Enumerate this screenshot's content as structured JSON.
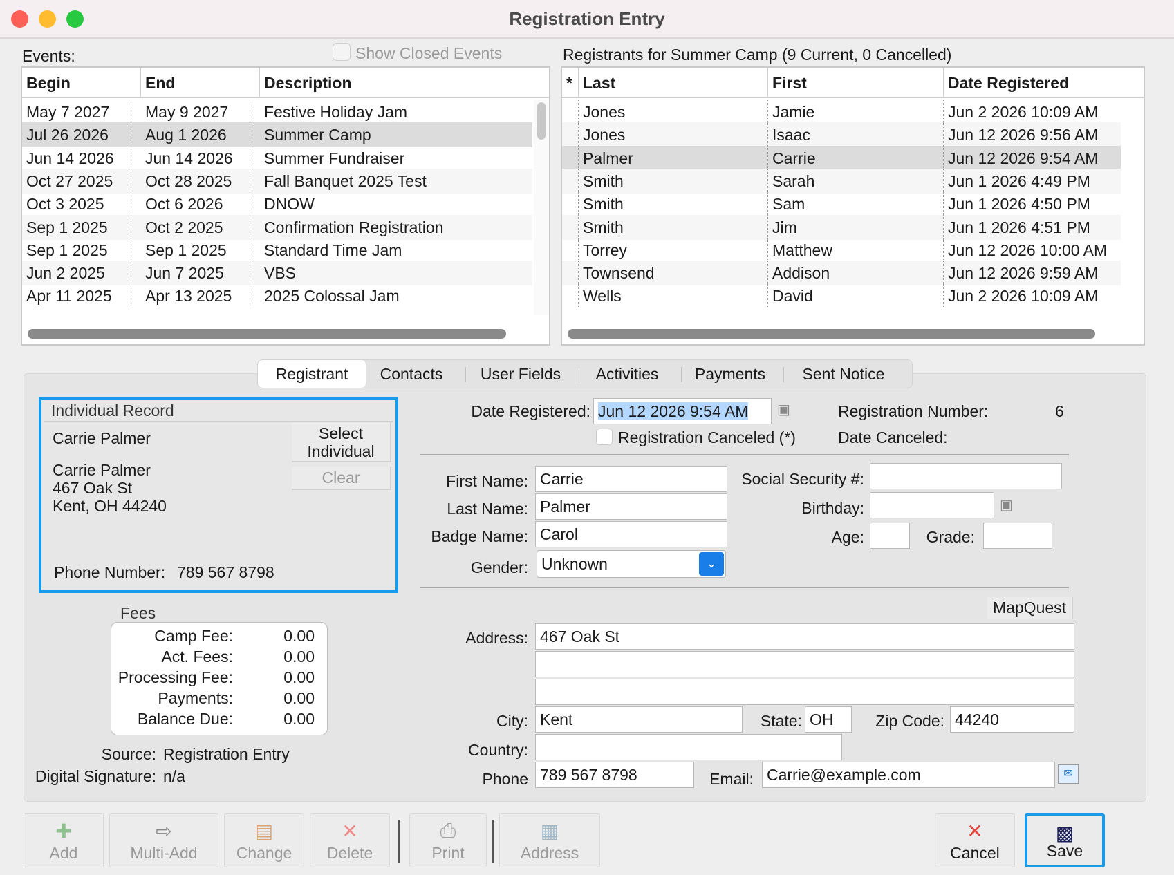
{
  "window": {
    "title": "Registration Entry"
  },
  "events": {
    "label": "Events:",
    "show_closed_label": "Show Closed Events",
    "columns": [
      "Begin",
      "End",
      "Description"
    ],
    "rows": [
      [
        "May 7 2027",
        "May 9 2027",
        "Festive Holiday Jam"
      ],
      [
        "Jul 26 2026",
        "Aug 1 2026",
        "Summer Camp"
      ],
      [
        "Jun 14 2026",
        "Jun 14 2026",
        "Summer Fundraiser"
      ],
      [
        "Oct 27 2025",
        "Oct 28 2025",
        "Fall Banquet 2025 Test"
      ],
      [
        "Oct 3 2025",
        "Oct 6 2026",
        "DNOW"
      ],
      [
        "Sep 1 2025",
        "Oct 2 2025",
        "Confirmation Registration"
      ],
      [
        "Sep 1 2025",
        "Sep 1 2025",
        "Standard Time Jam"
      ],
      [
        "Jun 2 2025",
        "Jun 7 2025",
        "VBS"
      ],
      [
        "Apr 11 2025",
        "Apr 13 2025",
        "2025 Colossal Jam"
      ]
    ],
    "selected_index": 1
  },
  "registrants": {
    "label": "Registrants for Summer Camp (9 Current, 0 Cancelled)",
    "columns": [
      "*",
      "Last",
      "First",
      "Date Registered"
    ],
    "rows": [
      [
        "",
        "Jones",
        "Jamie",
        "Jun 2 2026 10:09 AM"
      ],
      [
        "",
        "Jones",
        "Isaac",
        "Jun 12 2026 9:56 AM"
      ],
      [
        "",
        "Palmer",
        "Carrie",
        "Jun 12 2026 9:54 AM"
      ],
      [
        "",
        "Smith",
        "Sarah",
        "Jun 1 2026 4:49 PM"
      ],
      [
        "",
        "Smith",
        "Sam",
        "Jun 1 2026 4:50 PM"
      ],
      [
        "",
        "Smith",
        "Jim",
        "Jun 1 2026 4:51 PM"
      ],
      [
        "",
        "Torrey",
        "Matthew",
        "Jun 12 2026 10:00 AM"
      ],
      [
        "",
        "Townsend",
        "Addison",
        "Jun 12 2026 9:59 AM"
      ],
      [
        "",
        "Wells",
        "David",
        "Jun 2 2026 10:09 AM"
      ]
    ],
    "selected_index": 2
  },
  "tabs": [
    "Registrant",
    "Contacts",
    "User Fields",
    "Activities",
    "Payments",
    "Sent Notice"
  ],
  "individual": {
    "title": "Individual Record",
    "name": "Carrie Palmer",
    "address_name": "Carrie Palmer",
    "address_line1": "467 Oak St",
    "address_line2": "Kent, OH 44240",
    "phone_label": "Phone Number:",
    "phone": "789 567 8798",
    "select_label": "Select Individual",
    "clear_label": "Clear"
  },
  "fees": {
    "title": "Fees",
    "items": [
      {
        "label": "Camp Fee:",
        "value": "0.00"
      },
      {
        "label": "Act. Fees:",
        "value": "0.00"
      },
      {
        "label": "Processing Fee:",
        "value": "0.00"
      },
      {
        "label": "Payments:",
        "value": "0.00"
      },
      {
        "label": "Balance Due:",
        "value": "0.00"
      }
    ],
    "source_label": "Source:",
    "source": "Registration Entry",
    "signature_label": "Digital Signature:",
    "signature": "n/a"
  },
  "form": {
    "date_registered_label": "Date Registered:",
    "date_registered": "Jun 12 2026 9:54 AM",
    "registration_number_label": "Registration Number:",
    "registration_number": "6",
    "canceled_label": "Registration Canceled (*)",
    "date_canceled_label": "Date Canceled:",
    "first_name_label": "First Name:",
    "first_name": "Carrie",
    "last_name_label": "Last Name:",
    "last_name": "Palmer",
    "badge_name_label": "Badge Name:",
    "badge_name": "Carol",
    "gender_label": "Gender:",
    "gender": "Unknown",
    "ssn_label": "Social Security #:",
    "ssn": "",
    "birthday_label": "Birthday:",
    "birthday": "",
    "age_label": "Age:",
    "age": "",
    "grade_label": "Grade:",
    "grade": "",
    "mapquest_label": "MapQuest",
    "address_label": "Address:",
    "address1": "467 Oak St",
    "address2": "",
    "address3": "",
    "city_label": "City:",
    "city": "Kent",
    "state_label": "State:",
    "state": "OH",
    "zip_label": "Zip Code:",
    "zip": "44240",
    "country_label": "Country:",
    "country": "",
    "phone_label": "Phone",
    "phone": "789 567 8798",
    "email_label": "Email:",
    "email": "Carrie@example.com"
  },
  "toolbar": {
    "add": "Add",
    "multi_add": "Multi-Add",
    "change": "Change",
    "delete": "Delete",
    "print": "Print",
    "address": "Address",
    "cancel": "Cancel",
    "save": "Save"
  },
  "colors": {
    "accent": "#1a9bea",
    "selected_row": "#dcdcdc",
    "close": "#fe5f57",
    "minimize": "#febc2e",
    "zoom": "#28c840"
  },
  "icons": [
    "calendar-icon",
    "dropdown-chevron-icon",
    "add-icon",
    "multi-add-icon",
    "change-icon",
    "delete-icon",
    "print-icon",
    "address-icon",
    "cancel-icon",
    "save-icon",
    "email-icon"
  ]
}
